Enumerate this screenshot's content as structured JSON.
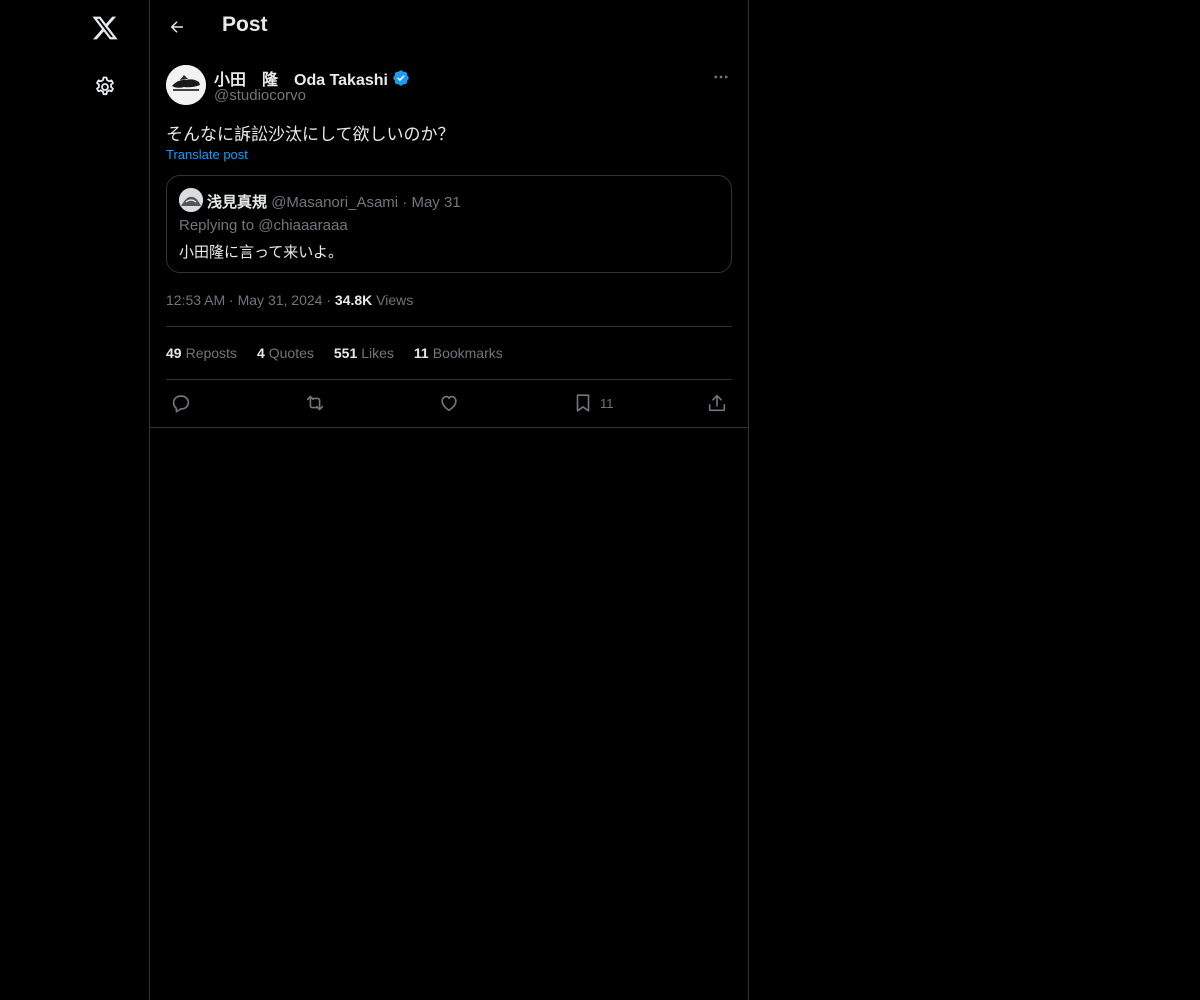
{
  "header": {
    "title": "Post"
  },
  "post": {
    "author_name": "小田　隆　Oda Takashi",
    "author_handle": "@studiocorvo",
    "text": "そんなに訴訟沙汰にして欲しいのか？",
    "translate_label": "Translate post",
    "quote": {
      "name": "浅見真規",
      "handle": "@Masanori_Asami",
      "separator": "·",
      "date": "May 31",
      "replying_to": "Replying to @chiaaaraaa",
      "text": "小田隆に言って来いよ。"
    },
    "meta": {
      "time": "12:53 AM",
      "separator": "·",
      "date": "May 31, 2024",
      "views_count": "34.8K",
      "views_label": "Views"
    },
    "stats": [
      {
        "count": "49",
        "label": "Reposts"
      },
      {
        "count": "4",
        "label": "Quotes"
      },
      {
        "count": "551",
        "label": "Likes"
      },
      {
        "count": "11",
        "label": "Bookmarks"
      }
    ],
    "actions": {
      "bookmark_count": "11"
    }
  },
  "colors": {
    "background": "#000000",
    "text_primary": "#e7e9ea",
    "text_secondary": "#71767b",
    "accent": "#1d9bf0",
    "border": "#2f3336"
  },
  "icons": {
    "logo": "x-logo-icon",
    "settings": "gear-icon",
    "back": "arrow-left-icon",
    "verified": "verified-badge-icon",
    "more": "more-horizontal-icon",
    "reply": "reply-icon",
    "repost": "repost-icon",
    "like": "heart-icon",
    "bookmark": "bookmark-icon",
    "share": "share-icon"
  }
}
